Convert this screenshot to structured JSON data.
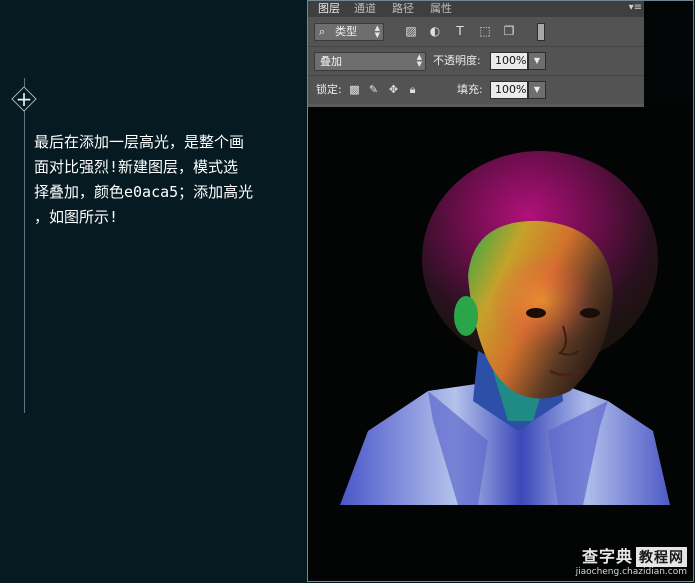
{
  "tutorial": {
    "step_marker": "+",
    "lines": [
      "最后在添加一层高光，是整个画",
      "面对比强烈!新建图层，模式选",
      "择叠加，颜色e0aca5；添加高光",
      "，如图所示!"
    ]
  },
  "layers_panel": {
    "tabs": [
      "图层",
      "通道",
      "路径",
      "属性"
    ],
    "active_tab": "图层",
    "menu_icon": "panel-menu-icon",
    "filter": {
      "icon": "search-icon",
      "label": "类型"
    },
    "filter_icons": [
      "image-icon",
      "adjustment-icon",
      "type-icon",
      "shape-icon",
      "smart-object-icon"
    ],
    "blend_mode": "叠加",
    "opacity_label": "不透明度:",
    "opacity_value": "100%",
    "lock_label": "锁定:",
    "lock_icons": [
      "lock-transparent-icon",
      "lock-paint-icon",
      "lock-move-icon",
      "lock-all-icon"
    ],
    "fill_label": "填充:",
    "fill_value": "100%"
  },
  "watermark": {
    "brand": "查字典",
    "brand_boxed": "教程网",
    "url": "jiaocheng.chazidian.com"
  },
  "colors": {
    "page_bg": "#061a22",
    "panel_bg": "#535353",
    "highlight_color": "#e0aca5"
  }
}
